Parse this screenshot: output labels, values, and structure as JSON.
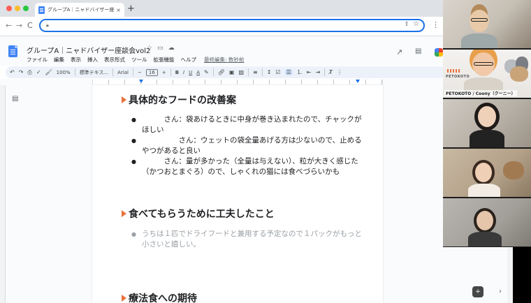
{
  "browser": {
    "tab_title": "グループA｜ニャドバイザー座談会",
    "tab_close": "×",
    "new_tab": "+",
    "nav": {
      "back": "←",
      "forward": "→",
      "reload": "C"
    }
  },
  "docs": {
    "title": "グループA｜ニャドバイザー座談会vol2",
    "menu": [
      "ファイル",
      "編集",
      "表示",
      "挿入",
      "表示形式",
      "ツール",
      "拡張機能",
      "ヘルプ"
    ],
    "last_edit": "最終編集: 数秒前"
  },
  "toolbar": {
    "zoom": "100%",
    "style": "標準テキス...",
    "font": "Arial",
    "font_size": "16",
    "minus": "−",
    "plus": "+",
    "bold": "B",
    "italic": "I",
    "underline": "U",
    "text_color": "A"
  },
  "document": {
    "section1": {
      "heading": "具体的なフードの改善案",
      "items": [
        "　　　さん：袋あけるときに中身が巻き込まれたので、チャックがほしい",
        "　　　　　さん：ウェットの袋全量あげる方は少ないので、止めるやつがあると良い",
        "　　　さん：量が多かった（全量は与えない）、粒が大きく感じた（かつおとまぐろ）ので、しゃくれの猫には食べづらいかも"
      ]
    },
    "section2": {
      "heading": "食べてもらうために工夫したこと",
      "items": [
        "うちは１匹でドライフードと兼用する予定なので１パックがもっと小さいと嬉しい。"
      ]
    },
    "section3": {
      "heading": "療法食への期待"
    }
  },
  "video": {
    "participant2_name": "PETOKOTO / Coony（クーニー）",
    "brand": "PETOKOTO"
  },
  "colors": {
    "heading_marker": "#e8713b",
    "accent": "#1a73e8"
  }
}
